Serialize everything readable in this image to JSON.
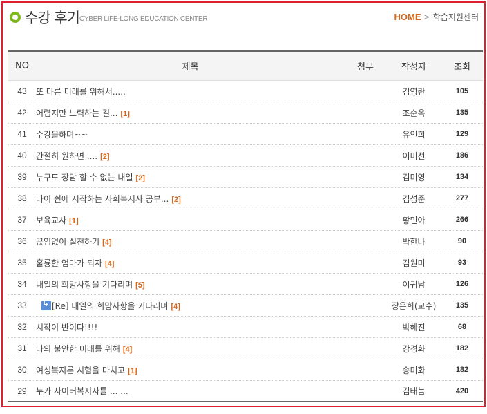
{
  "header": {
    "title": "수강 후기",
    "subtitle": "CYBER LIFE-LONG EDUCATION CENTER",
    "breadcrumb_home": "HOME",
    "breadcrumb_sep": ">",
    "breadcrumb_current": "학습지원센터"
  },
  "colors": {
    "accent": "#d5671c",
    "border": "#e01f2e",
    "dot": "#7fb81c"
  },
  "table": {
    "columns": {
      "no": "NO",
      "title": "제목",
      "attach": "첨부",
      "author": "작성자",
      "views": "조회"
    },
    "rows": [
      {
        "no": "43",
        "title": "또 다른 미래를 위해서.....",
        "comments": "",
        "author": "김영란",
        "views": "105"
      },
      {
        "no": "42",
        "title": "어렵지만 노력하는 길...",
        "comments": "[1]",
        "author": "조순옥",
        "views": "135"
      },
      {
        "no": "41",
        "title": "수강을하며~~",
        "comments": "",
        "author": "유인희",
        "views": "129"
      },
      {
        "no": "40",
        "title": "간절히 원하면 ....",
        "comments": "[2]",
        "author": "이미선",
        "views": "186"
      },
      {
        "no": "39",
        "title": "누구도 장담 할 수 없는 내일",
        "comments": "[2]",
        "author": "김미영",
        "views": "134"
      },
      {
        "no": "38",
        "title": "나이 쉰에 시작하는 사회복지사 공부...",
        "comments": "[2]",
        "author": "김성준",
        "views": "277"
      },
      {
        "no": "37",
        "title": "보육교사",
        "comments": "[1]",
        "author": "황민아",
        "views": "266"
      },
      {
        "no": "36",
        "title": "끊임없이 실천하기",
        "comments": "[4]",
        "author": "박한나",
        "views": "90"
      },
      {
        "no": "35",
        "title": "훌륭한 엄마가 되자",
        "comments": "[4]",
        "author": "김원미",
        "views": "93"
      },
      {
        "no": "34",
        "title": "내일의 희망사항을 기다리며",
        "comments": "[5]",
        "author": "이귀남",
        "views": "126"
      },
      {
        "no": "33",
        "title": "[Re] 내일의 희망사항을 기다리며",
        "comments": "[4]",
        "author": "장은희(교수)",
        "views": "135",
        "reply": true
      },
      {
        "no": "32",
        "title": "시작이 반이다!!!!",
        "comments": "",
        "author": "박혜진",
        "views": "68"
      },
      {
        "no": "31",
        "title": "나의 불안한 미래를 위해",
        "comments": "[4]",
        "author": "강경화",
        "views": "182"
      },
      {
        "no": "30",
        "title": "여성복지론 시험을 마치고",
        "comments": "[1]",
        "author": "송미화",
        "views": "182"
      },
      {
        "no": "29",
        "title": "누가 사이버복지사를 ... ...",
        "comments": "",
        "author": "김태늠",
        "views": "420"
      }
    ]
  }
}
